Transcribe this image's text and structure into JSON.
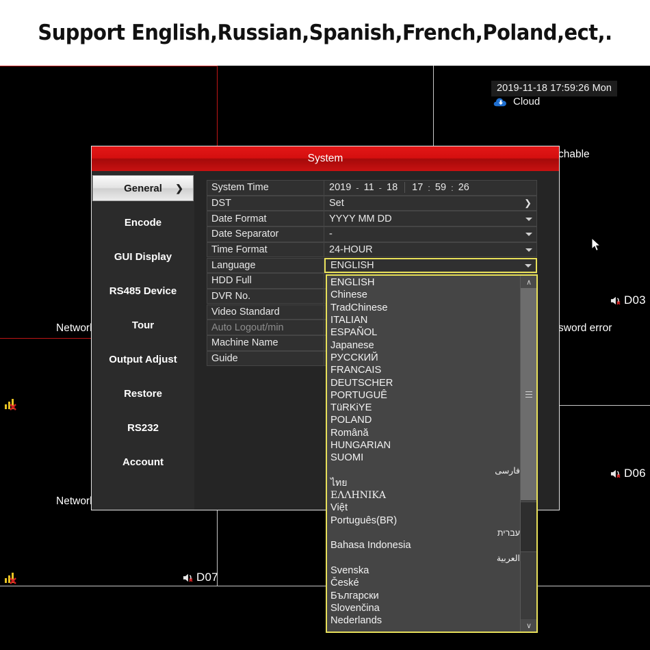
{
  "banner": {
    "text": "Support English,Russian,Spanish,French,Poland,ect,."
  },
  "wall": {
    "timestamp": "2019-11-18 17:59:26 Mon",
    "cloud_label": "Cloud",
    "overlays": [
      {
        "name": "channel-3-message",
        "text": "chable"
      },
      {
        "name": "channel-5-message",
        "text": "Network"
      },
      {
        "name": "channel-6-message",
        "text": "sword error"
      },
      {
        "name": "channel-7-message",
        "text": "Network"
      }
    ],
    "channels": [
      {
        "id": "D03"
      },
      {
        "id": "D06"
      },
      {
        "id": "D07"
      }
    ]
  },
  "dialog": {
    "title": "System",
    "sidebar": {
      "items": [
        {
          "label": "General",
          "active": true,
          "chevron": "❯"
        },
        {
          "label": "Encode",
          "active": false
        },
        {
          "label": "GUI Display",
          "active": false
        },
        {
          "label": "RS485 Device",
          "active": false
        },
        {
          "label": "Tour",
          "active": false
        },
        {
          "label": "Output Adjust",
          "active": false
        },
        {
          "label": "Restore",
          "active": false
        },
        {
          "label": "RS232",
          "active": false
        },
        {
          "label": "Account",
          "active": false
        }
      ]
    },
    "form": {
      "system_time": {
        "label": "System Time",
        "year": "2019",
        "month": "11",
        "day": "18",
        "hour": "17",
        "minute": "59",
        "second": "26",
        "date_sep": "-",
        "time_sep": ":"
      },
      "rows": [
        {
          "label": "DST",
          "value": "Set",
          "control": "arrow"
        },
        {
          "label": "Date Format",
          "value": "YYYY MM DD",
          "control": "select"
        },
        {
          "label": "Date Separator",
          "value": "-",
          "control": "select"
        },
        {
          "label": "Time Format",
          "value": "24-HOUR",
          "control": "select"
        },
        {
          "label": "Language",
          "value": "ENGLISH",
          "control": "select",
          "focused": true
        },
        {
          "label": "HDD Full",
          "value": "",
          "control": "none"
        },
        {
          "label": "DVR No.",
          "value": "",
          "control": "none"
        },
        {
          "label": "Video Standard",
          "value": "",
          "control": "none"
        },
        {
          "label": "Auto Logout/min",
          "value": "",
          "control": "none",
          "dim": true
        },
        {
          "label": "Machine Name",
          "value": "",
          "control": "none"
        },
        {
          "label": "Guide",
          "value": "",
          "control": "none"
        }
      ]
    }
  },
  "language_dropdown": {
    "selected": "ENGLISH",
    "scroll_up": "∧",
    "scroll_down": "∨",
    "options": [
      {
        "label": "ENGLISH",
        "script": "latin"
      },
      {
        "label": "Chinese",
        "script": "latin"
      },
      {
        "label": "TradChinese",
        "script": "latin"
      },
      {
        "label": "ITALIAN",
        "script": "latin"
      },
      {
        "label": "ESPAÑOL",
        "script": "latin"
      },
      {
        "label": "Japanese",
        "script": "latin"
      },
      {
        "label": "РУССКИЙ",
        "script": "cyrillic"
      },
      {
        "label": "FRANCAIS",
        "script": "latin"
      },
      {
        "label": "DEUTSCHER",
        "script": "latin"
      },
      {
        "label": "PORTUGUÊ",
        "script": "latin"
      },
      {
        "label": "TüRKiYE",
        "script": "latin"
      },
      {
        "label": "POLAND",
        "script": "latin"
      },
      {
        "label": "Română",
        "script": "latin"
      },
      {
        "label": "HUNGARIAN",
        "script": "latin"
      },
      {
        "label": "SUOMI",
        "script": "latin"
      },
      {
        "label": "فارسی",
        "script": "rtl"
      },
      {
        "label": "ไทย",
        "script": "thai"
      },
      {
        "label": "ΕΛΛΗΝΙΚΑ",
        "script": "greek"
      },
      {
        "label": "Việt",
        "script": "latin"
      },
      {
        "label": "Português(BR)",
        "script": "latin"
      },
      {
        "label": "עברית",
        "script": "rtl"
      },
      {
        "label": "Bahasa Indonesia",
        "script": "latin"
      },
      {
        "label": "العربية",
        "script": "rtl"
      },
      {
        "label": "Svenska",
        "script": "latin"
      },
      {
        "label": "České",
        "script": "latin"
      },
      {
        "label": "Български",
        "script": "cyrillic"
      },
      {
        "label": "Slovenčina",
        "script": "latin"
      },
      {
        "label": "Nederlands",
        "script": "latin"
      }
    ]
  },
  "colors": {
    "accent_red": "#d50f0f",
    "focus_yellow": "#e8e05a",
    "panel_dark": "#2b2b2b",
    "field_bg": "#303030",
    "dropdown_bg": "#454545",
    "cloud_blue": "#1f6fd0",
    "signal_yellow": "#e8c323",
    "error_red": "#d02020"
  }
}
